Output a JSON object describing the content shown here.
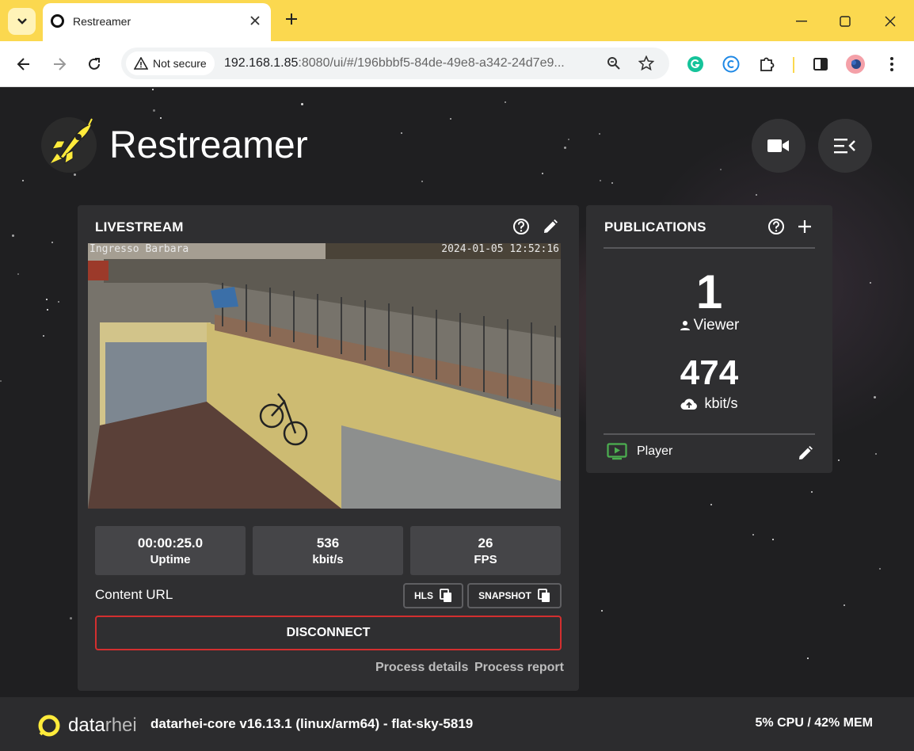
{
  "browser": {
    "tab_title": "Restreamer",
    "security_label": "Not secure",
    "url_host": "192.168.1.85",
    "url_rest": ":8080/ui/#/196bbbf5-84de-49e8-a342-24d7e9..."
  },
  "app": {
    "name": "Restreamer",
    "accent_color": "#ffeb3b",
    "livestream": {
      "title": "LIVESTREAM",
      "overlay_name": "Ingresso Barbara",
      "overlay_time": "2024-01-05 12:52:16",
      "stats": [
        {
          "value": "00:00:25.0",
          "label": "Uptime"
        },
        {
          "value": "536",
          "label": "kbit/s"
        },
        {
          "value": "26",
          "label": "FPS"
        }
      ],
      "content_url_label": "Content URL",
      "hls_label": "HLS",
      "snapshot_label": "SNAPSHOT",
      "disconnect_label": "DISCONNECT",
      "process_details_label": "Process details",
      "process_report_label": "Process report"
    },
    "publications": {
      "title": "PUBLICATIONS",
      "viewers": "1",
      "viewers_label": "Viewer",
      "bitrate": "474",
      "bitrate_label": "kbit/s",
      "player_label": "Player"
    },
    "footer": {
      "brand_a": "data",
      "brand_b": "rhei",
      "version": "datarhei-core v16.13.1 (linux/arm64) - flat-sky-5819",
      "system": "5% CPU / 42% MEM"
    }
  }
}
